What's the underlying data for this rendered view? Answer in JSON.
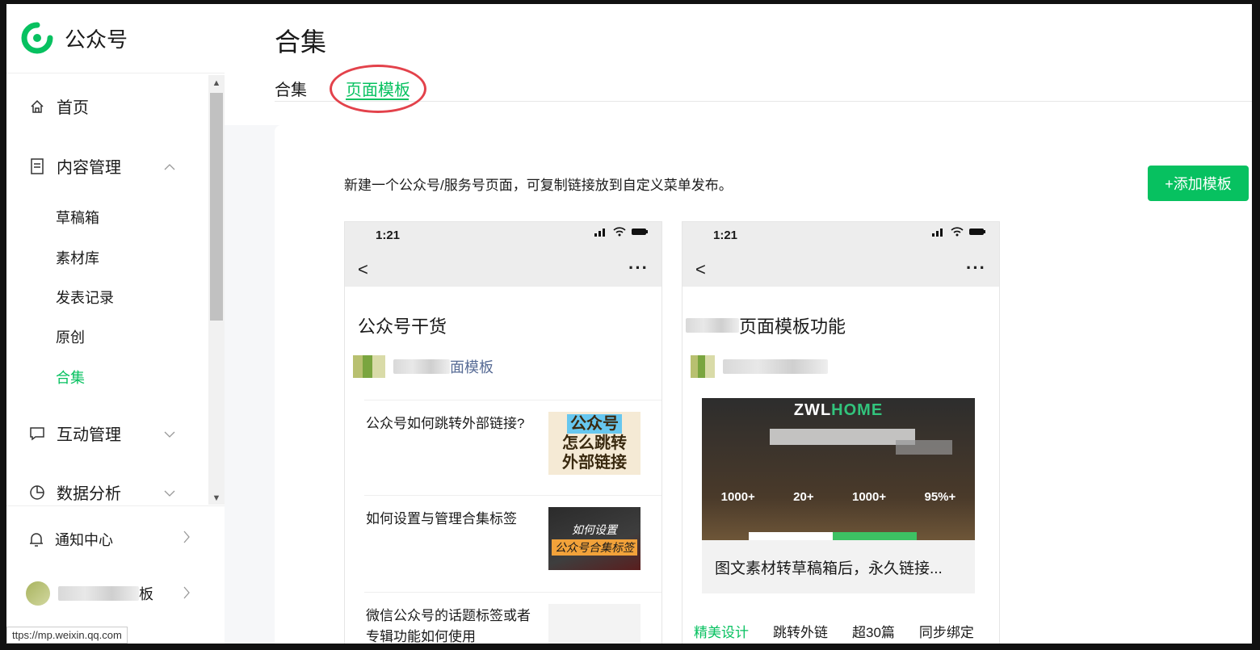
{
  "brand": {
    "name": "公众号"
  },
  "sidebar": {
    "home": "首页",
    "content_mgmt": "内容管理",
    "sub_items": [
      "草稿箱",
      "素材库",
      "发表记录",
      "原创",
      "合集"
    ],
    "interaction": "互动管理",
    "analytics": "数据分析",
    "notify": "通知中心",
    "account_suffix": "板"
  },
  "status_url": "ttps://mp.weixin.qq.com",
  "main": {
    "title": "合集",
    "tabs": [
      {
        "label": "合集"
      },
      {
        "label": "页面模板"
      }
    ],
    "description": "新建一个公众号/服务号页面，可复制链接放到自定义菜单发布。",
    "add_button": "+添加模板"
  },
  "phone1": {
    "time": "1:21",
    "title": "公众号干货",
    "author_suffix": "面模板",
    "articles": [
      {
        "title": "公众号如何跳转外部链接?",
        "thumb_lines": [
          "公众号",
          "怎么跳转",
          "外部链接"
        ]
      },
      {
        "title": "如何设置与管理合集标签",
        "thumb_lines": [
          "如何设置",
          "公众号合集标签"
        ]
      },
      {
        "title": "微信公众号的话题标签或者专辑功能如何使用"
      }
    ]
  },
  "phone2": {
    "time": "1:21",
    "title_suffix": "页面模板功能",
    "banner_brand_1": "ZWL",
    "banner_brand_2": "HOME",
    "banner_stats": [
      "1000+",
      "20+",
      "1000+",
      "95%+"
    ],
    "caption": "图文素材转草稿箱后，永久链接...",
    "tags": [
      "精美设计",
      "跳转外链",
      "超30篇",
      "同步绑定"
    ]
  }
}
